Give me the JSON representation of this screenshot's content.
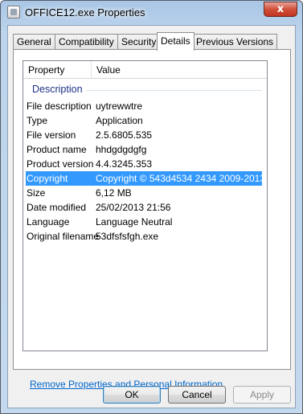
{
  "window": {
    "title": "OFFICE12.exe Properties",
    "close_glyph": "x"
  },
  "tabs": [
    {
      "label": "General"
    },
    {
      "label": "Compatibility"
    },
    {
      "label": "Security"
    },
    {
      "label": "Details",
      "active": true
    },
    {
      "label": "Previous Versions"
    }
  ],
  "details": {
    "columns": {
      "property": "Property",
      "value": "Value"
    },
    "group": "Description",
    "rows": [
      {
        "property": "File description",
        "value": "uytrewwtre"
      },
      {
        "property": "Type",
        "value": "Application"
      },
      {
        "property": "File version",
        "value": "2.5.6805.535"
      },
      {
        "property": "Product name",
        "value": "hhdgdgdgfg"
      },
      {
        "property": "Product version",
        "value": "4.4.3245.353"
      },
      {
        "property": "Copyright",
        "value": "Copyright © 543d4534 2434 2009-2013",
        "selected": true
      },
      {
        "property": "Size",
        "value": "6,12 MB"
      },
      {
        "property": "Date modified",
        "value": "25/02/2013 21:56"
      },
      {
        "property": "Language",
        "value": "Language Neutral"
      },
      {
        "property": "Original filename",
        "value": "53dfsfsfgh.exe"
      }
    ]
  },
  "link": {
    "remove": "Remove Properties and Personal Information"
  },
  "buttons": {
    "ok": "OK",
    "cancel": "Cancel",
    "apply": "Apply"
  },
  "colors": {
    "selection": "#3399ff",
    "link": "#0066cc",
    "group_header": "#1e3287"
  }
}
